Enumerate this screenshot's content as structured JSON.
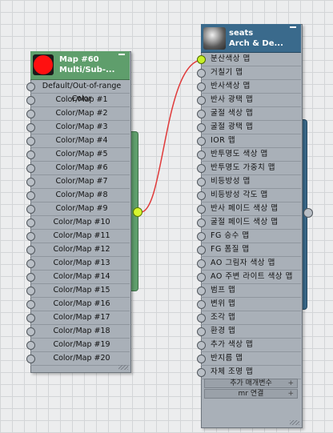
{
  "map_node": {
    "title": "Map #60",
    "subtitle": "Multi/Sub-...",
    "header_color": "#5f9e6c",
    "swatch_color": "#ff1010",
    "slots": [
      "Default/Out-of-range Color",
      "Color/Map #1",
      "Color/Map #2",
      "Color/Map #3",
      "Color/Map #4",
      "Color/Map #5",
      "Color/Map #6",
      "Color/Map #7",
      "Color/Map #8",
      "Color/Map #9",
      "Color/Map #10",
      "Color/Map #11",
      "Color/Map #12",
      "Color/Map #13",
      "Color/Map #14",
      "Color/Map #15",
      "Color/Map #16",
      "Color/Map #17",
      "Color/Map #18",
      "Color/Map #19",
      "Color/Map #20"
    ]
  },
  "material_node": {
    "title": "seats",
    "subtitle": "Arch & De...",
    "header_color": "#3a6a8c",
    "slots": [
      "분산색상 맵",
      "거칠기 맵",
      "반사색상 맵",
      "반사 광택 맵",
      "굴절 색상 맵",
      "굴절 광택 맵",
      "IOR 맵",
      "반투명도 색상 맵",
      "반투명도 가중치 맵",
      "비등방성 맵",
      "비등방성 각도 맵",
      "반사 페이드 색상 맵",
      "굴절 페이드 색상 맵",
      "FG 승수 맵",
      "FG 폼질 맵",
      "AO 그림자 색상 맵",
      "AO 주변 라이트 색상 맵",
      "범프 맵",
      "변위 맵",
      "조각 맵",
      "환경 맵",
      "추가 색상 맵",
      "반지름 맵",
      "자체 조명 맵"
    ],
    "rollouts": [
      "추가 매개변수",
      "mr 연결"
    ],
    "rollout_icon": "plus"
  },
  "connection": {
    "from": "Map #60",
    "to": "분산색상 맵",
    "wire_color": "#e03a3a"
  }
}
